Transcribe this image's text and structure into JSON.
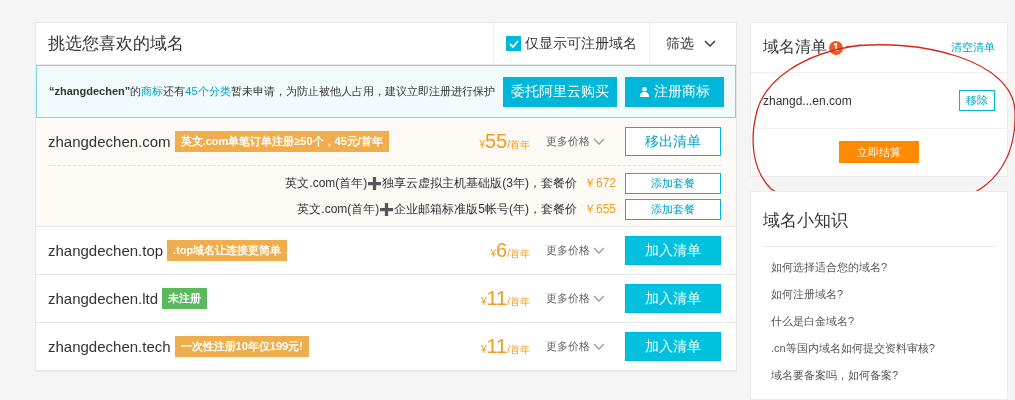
{
  "header": {
    "title": "挑选您喜欢的域名",
    "only_available": {
      "label": "仅显示可注册域名",
      "checked": true
    },
    "filter": {
      "label": "筛选"
    }
  },
  "notice": {
    "parts": [
      {
        "kind": "bold",
        "text": "“zhangdechen”"
      },
      {
        "kind": "plain",
        "text": "的"
      },
      {
        "kind": "link",
        "text": "商标"
      },
      {
        "kind": "plain",
        "text": "还有"
      },
      {
        "kind": "link",
        "text": "45个分类"
      },
      {
        "kind": "plain",
        "text": "暂未申请，为防止被他人占用，建议立即注册进行保护"
      }
    ],
    "buttons": [
      "委托阿里云购买",
      "注册商标"
    ]
  },
  "domains": [
    {
      "name": "zhangdechen.com",
      "tag": "英文.com单笔订单注册≥50个，45元/首年",
      "color": "#f0ad4e",
      "currency": "¥",
      "amount": "55",
      "unit": "/首年",
      "more": "更多价格",
      "in_cart": true,
      "action": "移出清单",
      "packages": [
        {
          "before": "英文.com(首年)",
          "after": "独享云虚拟主机基础版(3年)，套餐价",
          "price": "￥672",
          "button": "添加套餐"
        },
        {
          "before": "英文.com(首年)",
          "after": "企业邮箱标准版5帐号(年)，套餐价",
          "price": "￥655",
          "button": "添加套餐"
        }
      ]
    },
    {
      "name": "zhangdechen.top",
      "tag": ".top域名让连接更简单",
      "color": "#f0ad4e",
      "currency": "¥",
      "amount": "6",
      "unit": "/首年",
      "more": "更多价格",
      "in_cart": false,
      "action": "加入清单"
    },
    {
      "name": "zhangdechen.ltd",
      "tag": "未注册",
      "color": "#5cb85c",
      "currency": "¥",
      "amount": "11",
      "unit": "/首年",
      "more": "更多价格",
      "in_cart": false,
      "action": "加入清单"
    },
    {
      "name": "zhangdechen.tech",
      "tag": "一次性注册10年仅199元!",
      "color": "#f0ad4e",
      "currency": "¥",
      "amount": "11",
      "unit": "/首年",
      "more": "更多价格",
      "in_cart": false,
      "action": "加入清单"
    }
  ],
  "cart": {
    "title": "域名清单",
    "count": "1",
    "clear": "清空清单",
    "items": [
      {
        "name": "zhangd...en.com",
        "button": "移除"
      }
    ],
    "checkout": "立即结算"
  },
  "tips": {
    "title": "域名小知识",
    "items": [
      "如何选择适合您的域名?",
      "如何注册域名?",
      "什么是白金域名?",
      ".cn等国内域名如何提交资料审核?",
      "域名要备案吗，如何备案?"
    ]
  }
}
